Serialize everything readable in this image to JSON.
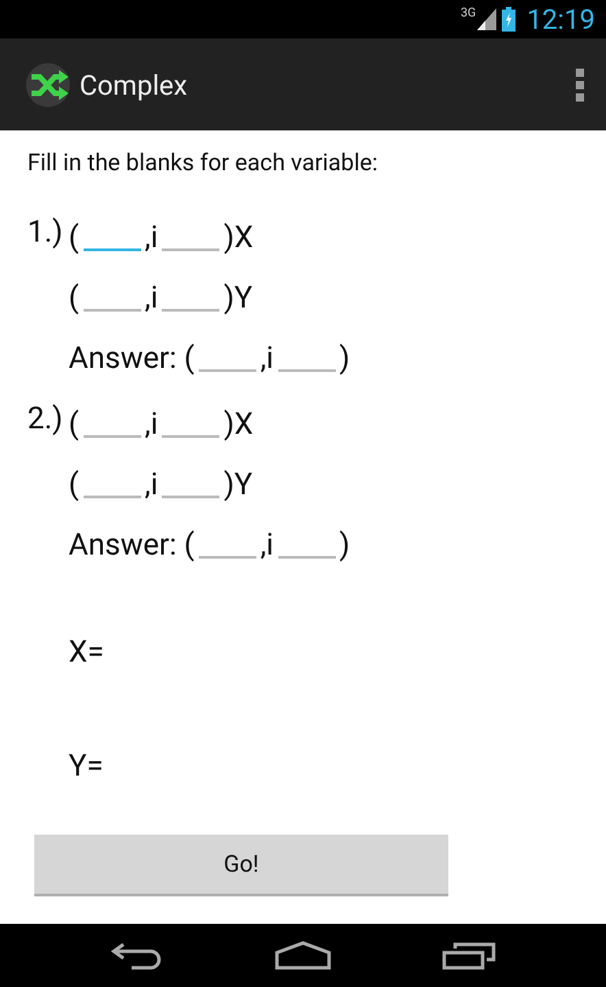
{
  "status_bar": {
    "network": "3G",
    "time": "12:19"
  },
  "action_bar": {
    "title": "Complex"
  },
  "instruction": "Fill in the blanks for each variable:",
  "problems": [
    {
      "number": "1.)",
      "rows": [
        {
          "prefix": "(",
          "separator": ",i",
          "suffix": ")X",
          "fields": [
            {
              "focused": true
            },
            {
              "focused": false
            }
          ]
        },
        {
          "prefix": "(",
          "separator": ",i",
          "suffix": ")Y",
          "fields": [
            {
              "focused": false
            },
            {
              "focused": false
            }
          ]
        },
        {
          "prefix": "Answer: (",
          "separator": ",i",
          "suffix": ")",
          "fields": [
            {
              "focused": false
            },
            {
              "focused": false
            }
          ]
        }
      ]
    },
    {
      "number": "2.)",
      "rows": [
        {
          "prefix": "(",
          "separator": ",i",
          "suffix": ")X",
          "fields": [
            {
              "focused": false
            },
            {
              "focused": false
            }
          ]
        },
        {
          "prefix": "(",
          "separator": ",i",
          "suffix": ")Y",
          "fields": [
            {
              "focused": false
            },
            {
              "focused": false
            }
          ]
        },
        {
          "prefix": "Answer: (",
          "separator": ",i",
          "suffix": ")",
          "fields": [
            {
              "focused": false
            },
            {
              "focused": false
            }
          ]
        }
      ]
    }
  ],
  "results": [
    {
      "label": "X="
    },
    {
      "label": "Y="
    }
  ],
  "button": "Go!"
}
